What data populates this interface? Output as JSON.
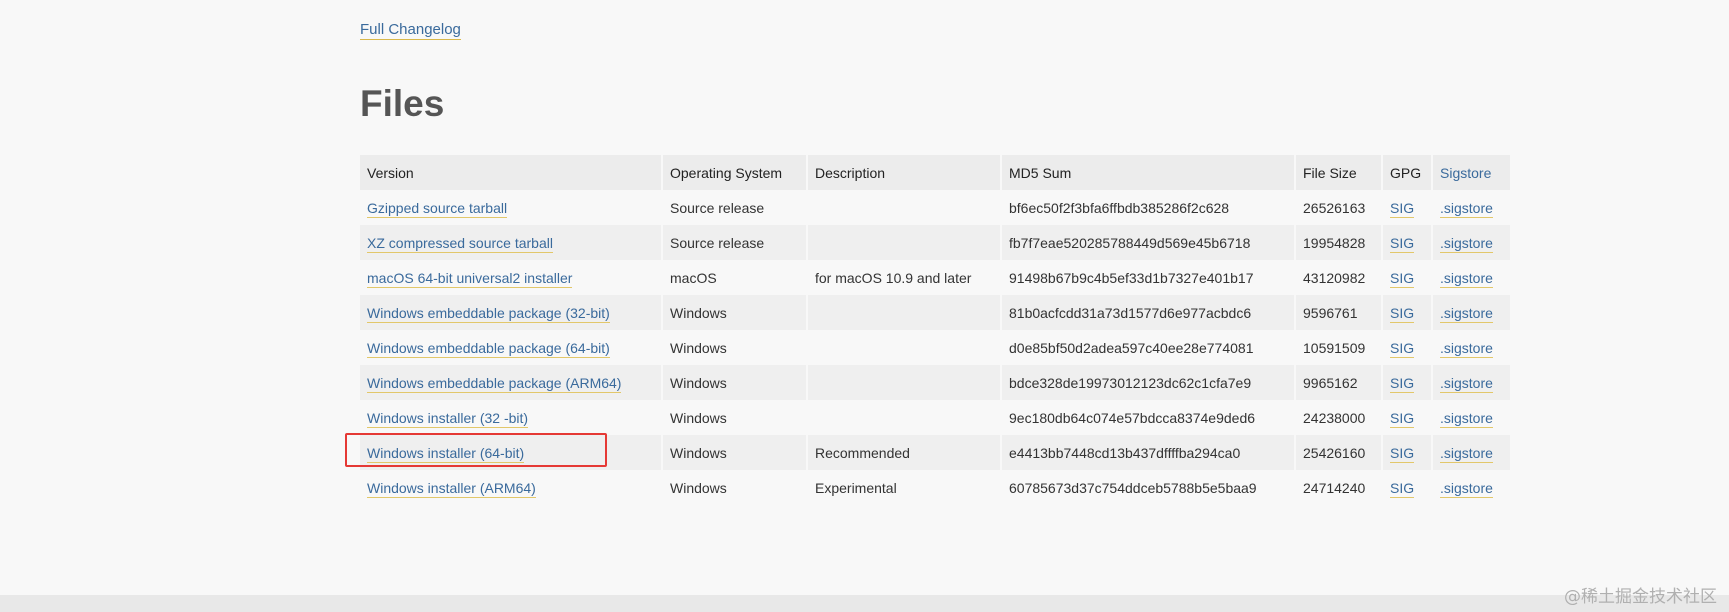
{
  "changelog_link": "Full Changelog",
  "heading": "Files",
  "table": {
    "headers": [
      "Version",
      "Operating System",
      "Description",
      "MD5 Sum",
      "File Size",
      "GPG",
      "Sigstore"
    ],
    "rows": [
      {
        "version": "Gzipped source tarball",
        "os": "Source release",
        "description": "",
        "md5": "bf6ec50f2f3bfa6ffbdb385286f2c628",
        "size": "26526163",
        "gpg": "SIG",
        "sigstore": ".sigstore"
      },
      {
        "version": "XZ compressed source tarball",
        "os": "Source release",
        "description": "",
        "md5": "fb7f7eae520285788449d569e45b6718",
        "size": "19954828",
        "gpg": "SIG",
        "sigstore": ".sigstore"
      },
      {
        "version": "macOS 64-bit universal2 installer",
        "os": "macOS",
        "description": "for macOS 10.9 and later",
        "md5": "91498b67b9c4b5ef33d1b7327e401b17",
        "size": "43120982",
        "gpg": "SIG",
        "sigstore": ".sigstore"
      },
      {
        "version": "Windows embeddable package (32-bit)",
        "os": "Windows",
        "description": "",
        "md5": "81b0acfcdd31a73d1577d6e977acbdc6",
        "size": "9596761",
        "gpg": "SIG",
        "sigstore": ".sigstore"
      },
      {
        "version": "Windows embeddable package (64-bit)",
        "os": "Windows",
        "description": "",
        "md5": "d0e85bf50d2adea597c40ee28e774081",
        "size": "10591509",
        "gpg": "SIG",
        "sigstore": ".sigstore"
      },
      {
        "version": "Windows embeddable package (ARM64)",
        "os": "Windows",
        "description": "",
        "md5": "bdce328de19973012123dc62c1cfa7e9",
        "size": "9965162",
        "gpg": "SIG",
        "sigstore": ".sigstore"
      },
      {
        "version": "Windows installer (32 -bit)",
        "os": "Windows",
        "description": "",
        "md5": "9ec180db64c074e57bdcca8374e9ded6",
        "size": "24238000",
        "gpg": "SIG",
        "sigstore": ".sigstore"
      },
      {
        "version": "Windows installer (64-bit)",
        "os": "Windows",
        "description": "Recommended",
        "md5": "e4413bb7448cd13b437dffffba294ca0",
        "size": "25426160",
        "gpg": "SIG",
        "sigstore": ".sigstore"
      },
      {
        "version": "Windows installer (ARM64)",
        "os": "Windows",
        "description": "Experimental",
        "md5": "60785673d37c754ddceb5788b5e5baa9",
        "size": "24714240",
        "gpg": "SIG",
        "sigstore": ".sigstore"
      }
    ]
  },
  "watermark": "@稀土掘金技术社区",
  "colors": {
    "link": "#3a6a9c",
    "link_underline": "#e2c76a",
    "highlight": "#e53935"
  }
}
